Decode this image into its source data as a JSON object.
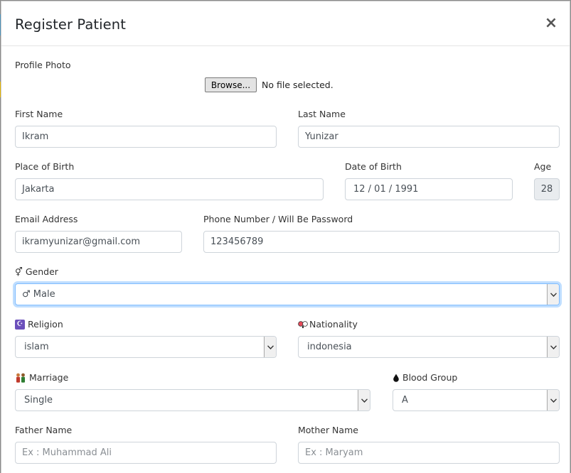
{
  "modal": {
    "title": "Register Patient",
    "close_label": "×"
  },
  "profile_photo": {
    "label": "Profile Photo",
    "browse_label": "Browse...",
    "file_status": "No file selected."
  },
  "first_name": {
    "label": "First Name",
    "value": "Ikram"
  },
  "last_name": {
    "label": "Last Name",
    "value": "Yunizar"
  },
  "place_of_birth": {
    "label": "Place of Birth",
    "value": "Jakarta"
  },
  "date_of_birth": {
    "label": "Date of Birth",
    "value": "12 / 01 / 1991"
  },
  "age": {
    "label": "Age",
    "value": "28"
  },
  "email": {
    "label": "Email Address",
    "value": "ikramyunizar@gmail.com"
  },
  "phone": {
    "label": "Phone Number / Will Be Password",
    "value": "123456789"
  },
  "gender": {
    "label": "Gender",
    "label_icon": "gender-icon",
    "value": "♂ Male",
    "value_icon": "male-icon"
  },
  "religion": {
    "label": "Religion",
    "label_icon": "religion-icon",
    "value": "islam"
  },
  "nationality": {
    "label": "Nationality",
    "label_icon": "nationality-icon",
    "value": "indonesia"
  },
  "marriage": {
    "label": "Marriage",
    "label_icon": "couple-icon",
    "value": "Single"
  },
  "blood_group": {
    "label": "Blood Group",
    "label_icon": "blood-drop-icon",
    "value": "A"
  },
  "father_name": {
    "label": "Father Name",
    "placeholder": "Ex : Muhammad Ali"
  },
  "mother_name": {
    "label": "Mother Name",
    "placeholder": "Ex : Maryam"
  },
  "colors": {
    "focus_border": "#80bdff",
    "readonly_bg": "#e9ecef",
    "religion_icon_bg": "#6b4fbb",
    "backdrop_accent": "#4a90b8"
  }
}
